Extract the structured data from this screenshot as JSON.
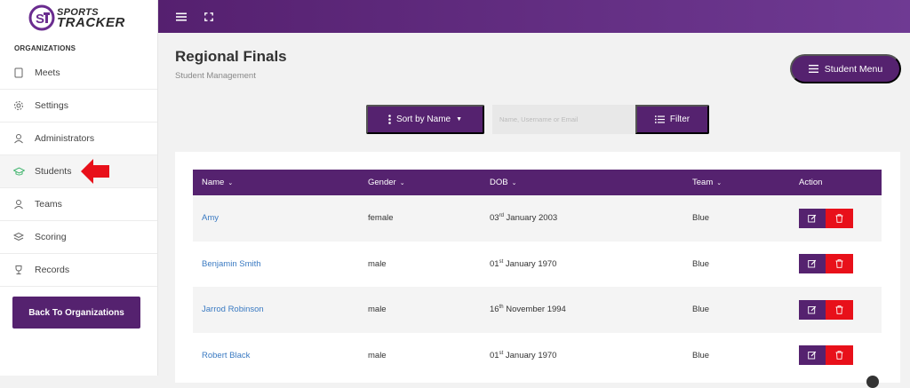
{
  "brand": {
    "line1": "SPORTS",
    "line2": "TRACKER",
    "accent": "#55226f"
  },
  "sidebar": {
    "section_label": "ORGANIZATIONS",
    "items": [
      {
        "label": "Meets",
        "icon": "clipboard-icon"
      },
      {
        "label": "Settings",
        "icon": "gear-icon"
      },
      {
        "label": "Administrators",
        "icon": "user-icon"
      },
      {
        "label": "Students",
        "icon": "graduation-cap-icon",
        "active": true
      },
      {
        "label": "Teams",
        "icon": "users-icon"
      },
      {
        "label": "Scoring",
        "icon": "layers-icon"
      },
      {
        "label": "Records",
        "icon": "trophy-icon"
      }
    ],
    "back_button": "Back To Organizations"
  },
  "topbar": {
    "icons": [
      "hamburger-icon",
      "fullscreen-icon"
    ]
  },
  "page": {
    "title": "Regional Finals",
    "subtitle": "Student Management",
    "student_menu_label": "Student Menu"
  },
  "toolbar": {
    "sort_label": "Sort by Name",
    "search_placeholder": "Name, Username or Email",
    "filter_label": "Filter"
  },
  "table": {
    "headers": {
      "name": "Name",
      "gender": "Gender",
      "dob": "DOB",
      "team": "Team",
      "action": "Action"
    },
    "rows": [
      {
        "name": "Amy",
        "gender": "female",
        "dob_day": "03",
        "dob_suffix": "rd",
        "dob_rest": " January 2003",
        "team": "Blue"
      },
      {
        "name": "Benjamin Smith",
        "gender": "male",
        "dob_day": "01",
        "dob_suffix": "st",
        "dob_rest": " January 1970",
        "team": "Blue"
      },
      {
        "name": "Jarrod Robinson",
        "gender": "male",
        "dob_day": "16",
        "dob_suffix": "th",
        "dob_rest": " November 1994",
        "team": "Blue"
      },
      {
        "name": "Robert Black",
        "gender": "male",
        "dob_day": "01",
        "dob_suffix": "st",
        "dob_rest": " January 1970",
        "team": "Blue"
      }
    ]
  }
}
